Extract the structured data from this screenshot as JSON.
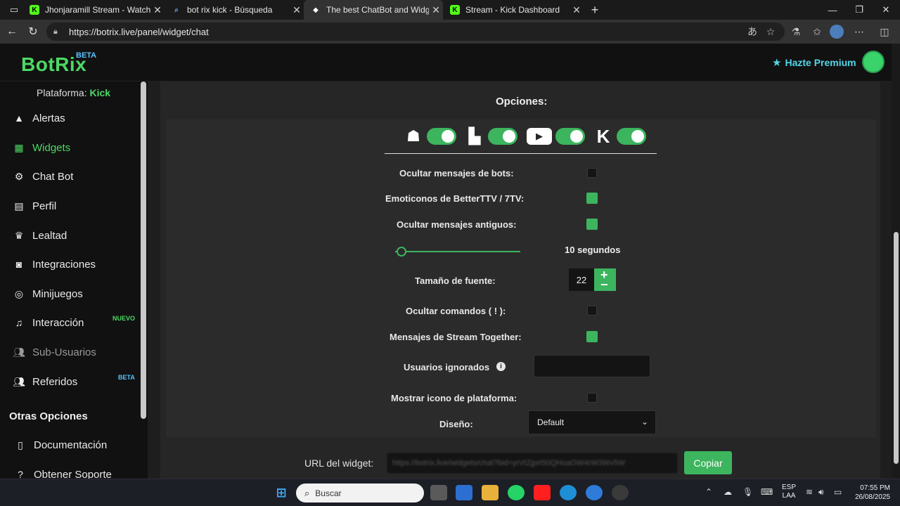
{
  "browser": {
    "tabs": [
      {
        "title": "Jhonjaramill Stream - Watch Live",
        "favicon": "kick-icon"
      },
      {
        "title": "bot rix kick - Búsqueda",
        "favicon": "search-icon"
      },
      {
        "title": "The best ChatBot and Widgets for",
        "favicon": "botrix-icon"
      },
      {
        "title": "Stream - Kick Dashboard",
        "favicon": "kick-icon"
      }
    ],
    "url": "https://botrix.live/panel/widget/chat"
  },
  "header": {
    "logo": "BotRix",
    "badge": "BETA",
    "premium_label": "Hazte Premium",
    "accent": "#4cd964",
    "premium_color": "#53d6e8"
  },
  "sidebar": {
    "platform_label": "Plataforma:",
    "platform_value": "Kick",
    "items": [
      {
        "label": "Alertas",
        "icon": "warning-icon"
      },
      {
        "label": "Widgets",
        "icon": "grid-icon"
      },
      {
        "label": "Chat Bot",
        "icon": "robot-icon"
      },
      {
        "label": "Perfil",
        "icon": "id-card-icon"
      },
      {
        "label": "Lealtad",
        "icon": "trophy-icon"
      },
      {
        "label": "Integraciones",
        "icon": "discord-icon"
      },
      {
        "label": "Minijuegos",
        "icon": "gamepad-icon"
      },
      {
        "label": "Interacción",
        "icon": "music-icon",
        "badge": "NUEVO"
      },
      {
        "label": "Sub-Usuarios",
        "icon": "users-icon"
      },
      {
        "label": "Referidos",
        "icon": "user-friends-icon",
        "badge": "BETA"
      }
    ],
    "other_title": "Otras Opciones",
    "other_items": [
      {
        "label": "Documentación",
        "icon": "document-icon"
      },
      {
        "label": "Obtener Soporte",
        "icon": "question-icon"
      }
    ]
  },
  "options": {
    "title": "Opciones:",
    "platforms": [
      "trovo",
      "twitch",
      "youtube",
      "kick"
    ],
    "hide_bots": "Ocultar mensajes de bots:",
    "emotes": "Emoticonos de BetterTTV / 7TV:",
    "hide_old": "Ocultar mensajes antiguos:",
    "old_seconds": "10 segundos",
    "slider_value": 0.05,
    "font_size_label": "Tamaño de fuente:",
    "font_size": "22",
    "hide_commands": "Ocultar comandos ( ! ):",
    "stream_together": "Mensajes de Stream Together:",
    "ignored_users": "Usuarios ignorados",
    "show_platform_icon": "Mostrar icono de plataforma:",
    "design_label": "Diseño:",
    "design_value": "Default",
    "widget_url_label": "URL del widget:",
    "widget_url": "https://botrix.live/widgets/chat?bid=yrVtZjprt50QHoaOW4rW3Wv5W",
    "copy_label": "Copiar"
  },
  "taskbar": {
    "search_placeholder": "Buscar",
    "lang_top": "ESP",
    "lang_bottom": "LAA",
    "time": "07:55 PM",
    "date": "26/08/2025"
  }
}
